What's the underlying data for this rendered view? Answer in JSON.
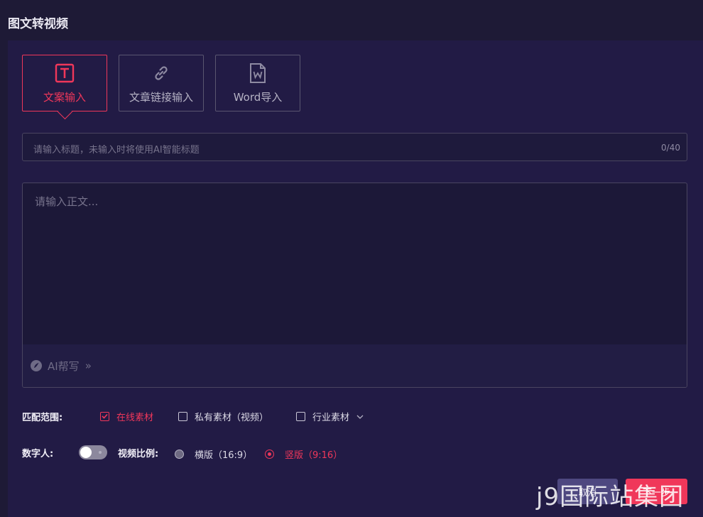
{
  "page_title": "图文转视频",
  "tabs": [
    {
      "label": "文案输入",
      "icon": "text-t-icon",
      "active": true
    },
    {
      "label": "文章链接输入",
      "icon": "link-icon",
      "active": false
    },
    {
      "label": "Word导入",
      "icon": "word-doc-icon",
      "active": false
    }
  ],
  "title_input": {
    "placeholder": "请输入标题，未输入时将使用AI智能标题",
    "counter": "0/40"
  },
  "body_input": {
    "placeholder": "请输入正文..."
  },
  "ai_write": {
    "label": "AI帮写",
    "arrow": "»"
  },
  "match_scope": {
    "label": "匹配范围:",
    "options": [
      {
        "label": "在线素材",
        "checked": true
      },
      {
        "label": "私有素材（视频）",
        "checked": false
      },
      {
        "label": "行业素材",
        "checked": false
      }
    ]
  },
  "digital_human": {
    "label": "数字人:",
    "enabled": false
  },
  "video_ratio": {
    "label": "视频比例:",
    "options": [
      {
        "label": "横版（16:9）",
        "selected": false
      },
      {
        "label": "竖版（9:16）",
        "selected": true
      }
    ]
  },
  "actions": {
    "cancel_label": "取消",
    "next_label": "下一步"
  },
  "watermark": "j9国际站集团",
  "colors": {
    "accent": "#f0375a",
    "background": "#1e1a36",
    "panel": "#221b45"
  }
}
